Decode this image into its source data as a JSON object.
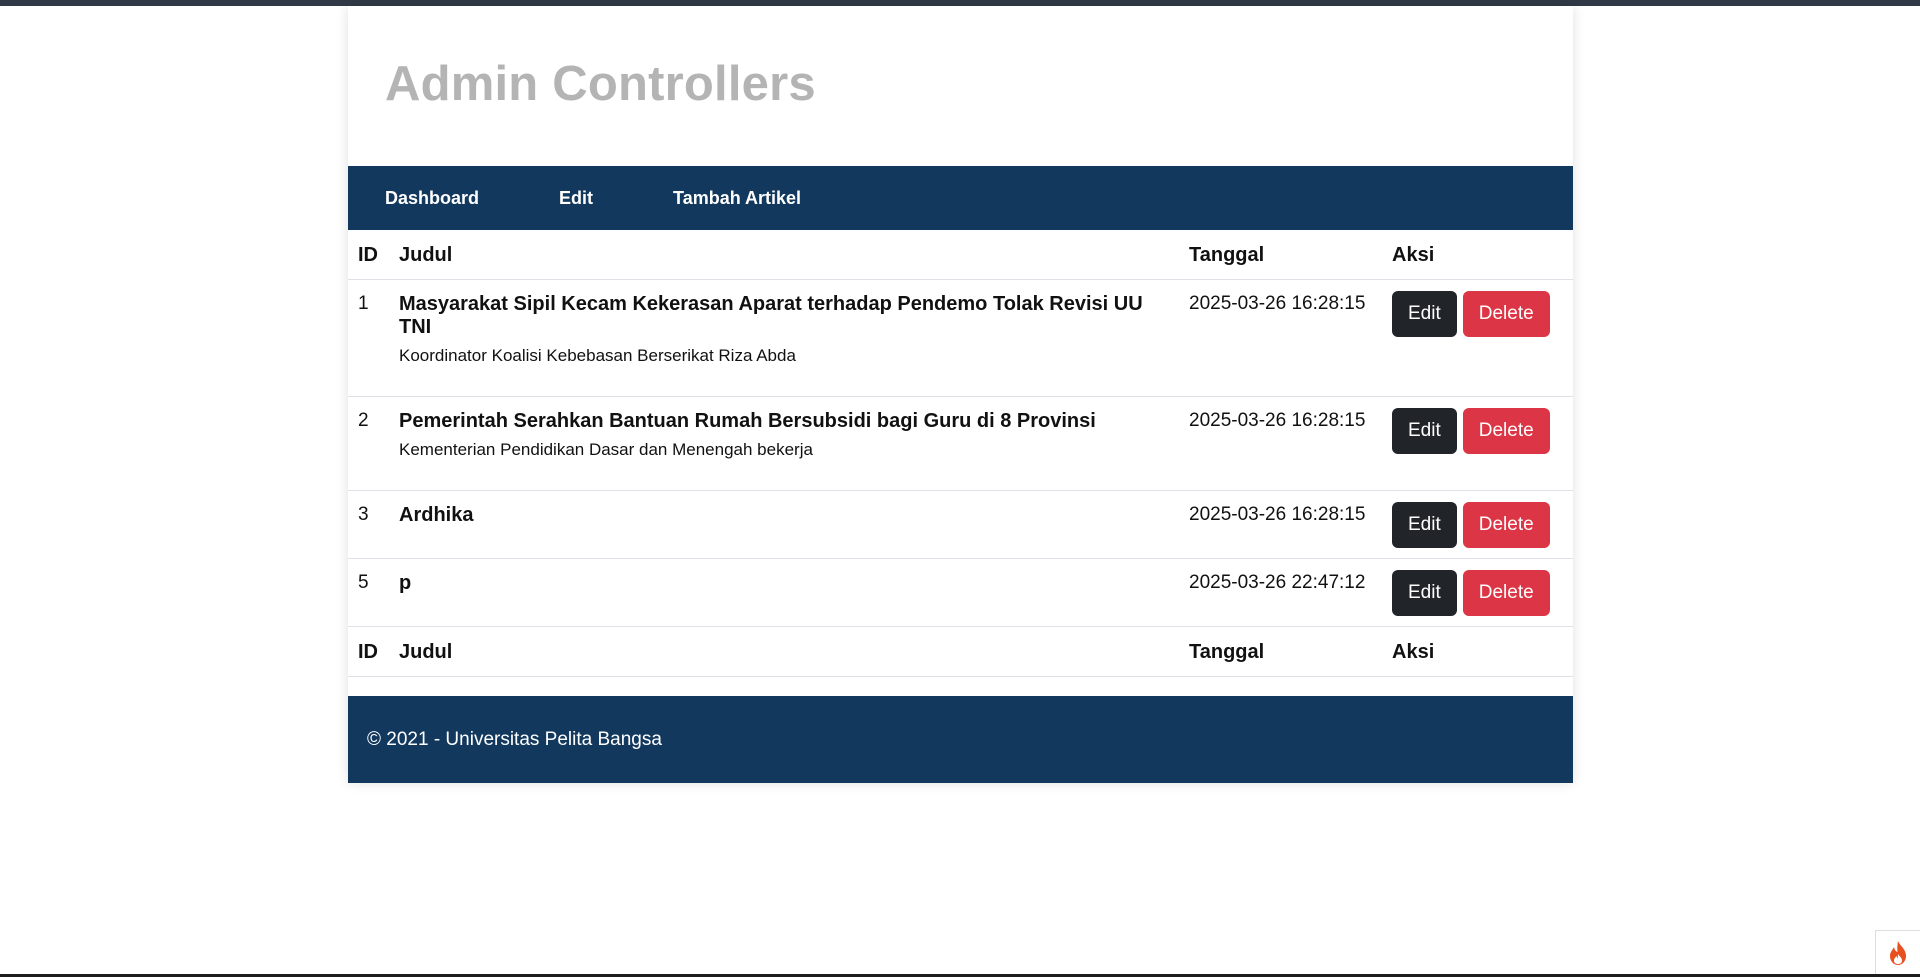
{
  "header": {
    "title": "Admin Controllers"
  },
  "nav": {
    "items": [
      {
        "label": "Dashboard"
      },
      {
        "label": "Edit"
      },
      {
        "label": "Tambah Artikel"
      }
    ]
  },
  "table": {
    "columns": {
      "id": "ID",
      "title": "Judul",
      "date": "Tanggal",
      "actions": "Aksi"
    },
    "rows": [
      {
        "id": "1",
        "title": "Masyarakat Sipil Kecam Kekerasan Aparat terhadap Pendemo Tolak Revisi UU TNI",
        "summary": "Koordinator Koalisi Kebebasan Berserikat Riza Abda",
        "date": "2025-03-26 16:28:15"
      },
      {
        "id": "2",
        "title": "Pemerintah Serahkan Bantuan Rumah Bersubsidi bagi Guru di 8 Provinsi",
        "summary": "Kementerian Pendidikan Dasar dan Menengah bekerja",
        "date": "2025-03-26 16:28:15"
      },
      {
        "id": "3",
        "title": "Ardhika",
        "summary": "",
        "date": "2025-03-26 16:28:15"
      },
      {
        "id": "5",
        "title": "p",
        "summary": "",
        "date": "2025-03-26 22:47:12"
      }
    ],
    "edit_label": "Edit",
    "delete_label": "Delete"
  },
  "footer": {
    "text": "© 2021 - Universitas Pelita Bangsa"
  },
  "colors": {
    "nav_bg": "#12385e",
    "title": "#b4b4b4",
    "edit_button": "#212529",
    "delete_button": "#dc3545"
  },
  "icons": {
    "corner": "flame-icon"
  }
}
